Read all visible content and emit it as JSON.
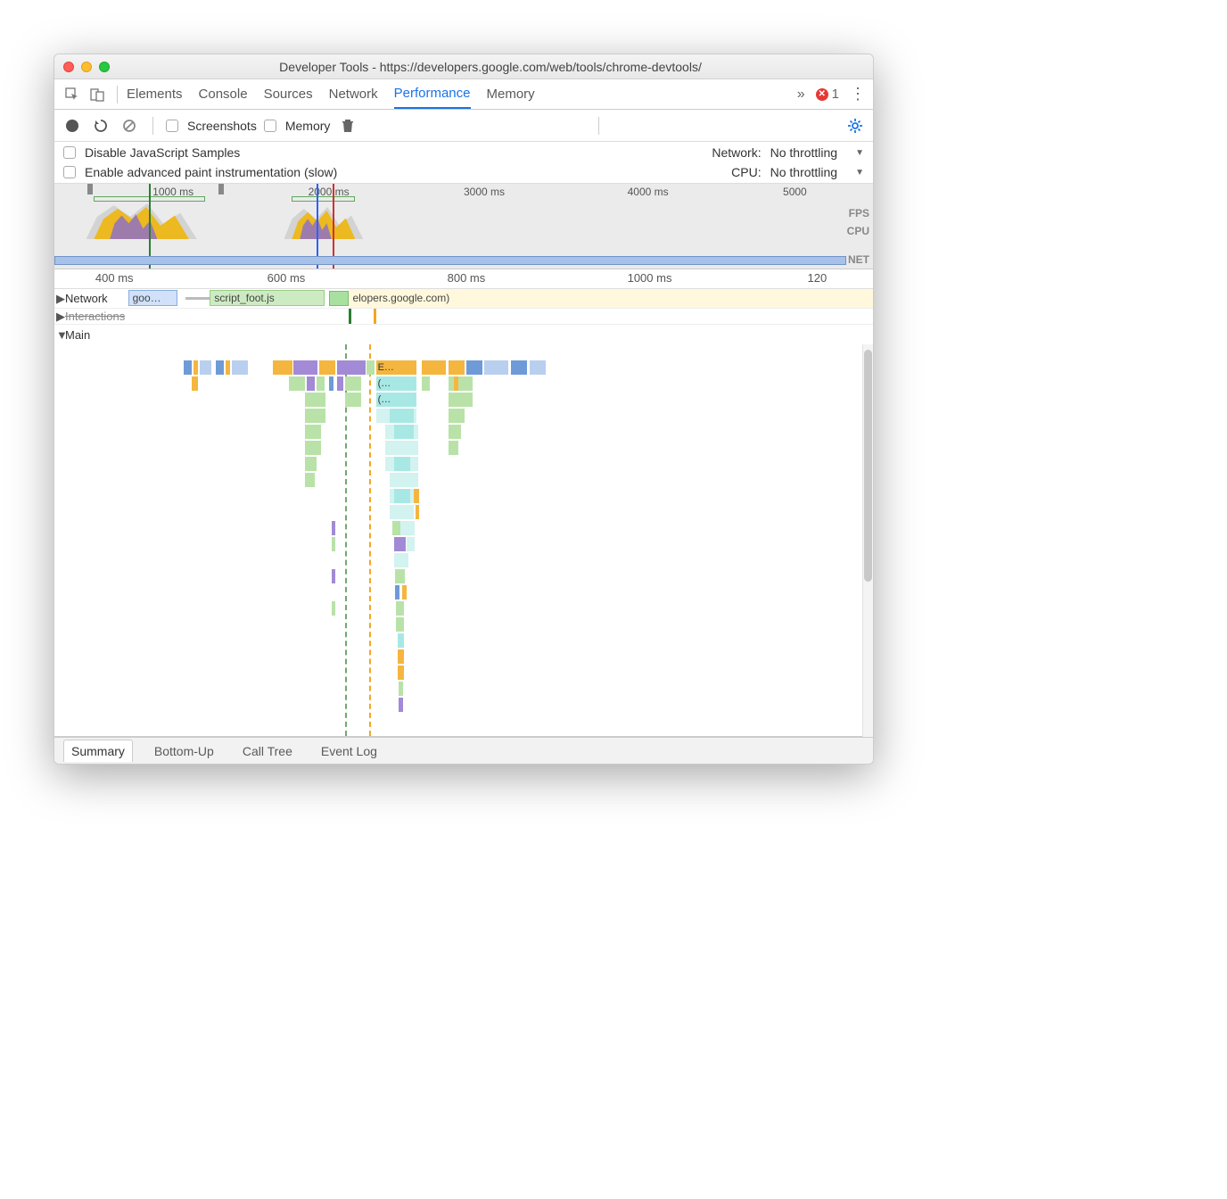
{
  "window": {
    "title": "Developer Tools - https://developers.google.com/web/tools/chrome-devtools/"
  },
  "tabs": {
    "items": [
      "Elements",
      "Console",
      "Sources",
      "Network",
      "Performance",
      "Memory"
    ],
    "active": "Performance",
    "overflow_glyph": "»",
    "error_count": "1"
  },
  "toolbar": {
    "screenshots_label": "Screenshots",
    "memory_label": "Memory"
  },
  "settings": {
    "disable_js_label": "Disable JavaScript Samples",
    "paint_instr_label": "Enable advanced paint instrumentation (slow)",
    "network_label": "Network:",
    "network_value": "No throttling",
    "cpu_label": "CPU:",
    "cpu_value": "No throttling"
  },
  "overview": {
    "ticks": [
      "1000 ms",
      "2000 ms",
      "3000 ms",
      "4000 ms",
      "5000"
    ],
    "tick_positions_pct": [
      12,
      31,
      50,
      70,
      89
    ],
    "side_labels": [
      "FPS",
      "CPU",
      "NET"
    ]
  },
  "ruler": {
    "ticks": [
      "400 ms",
      "600 ms",
      "800 ms",
      "1000 ms",
      "120"
    ],
    "tick_positions_pct": [
      5,
      26,
      48,
      70,
      92
    ]
  },
  "lanes": {
    "network": {
      "label": "Network",
      "chips": [
        {
          "label": "goo…",
          "left_pct": 10,
          "width_pct": 6,
          "cls": "blue"
        },
        {
          "label": "script_foot.js",
          "left_pct": 19,
          "width_pct": 14,
          "cls": "green"
        },
        {
          "label": "elopers.google.com)",
          "left_pct": 36,
          "width_pct": 25,
          "cls": ""
        }
      ]
    },
    "interactions": {
      "label": "Interactions"
    },
    "main": {
      "label": "Main"
    },
    "flame_text": {
      "e": "E…",
      "p1": "(…",
      "p2": "(…"
    }
  },
  "bottom_tabs": {
    "items": [
      "Summary",
      "Bottom-Up",
      "Call Tree",
      "Event Log"
    ],
    "active": "Summary"
  }
}
